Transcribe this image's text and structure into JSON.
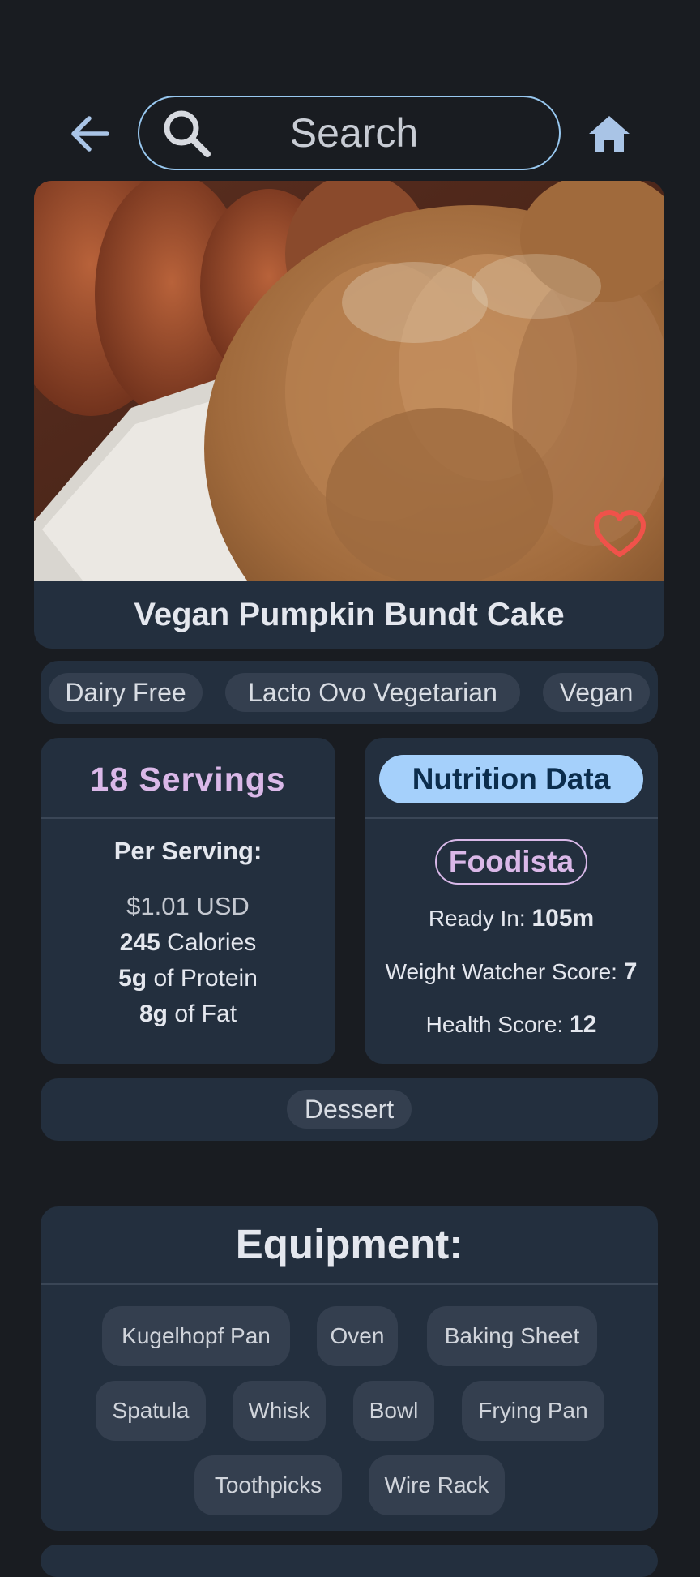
{
  "search": {
    "placeholder": "Search"
  },
  "recipe": {
    "title": "Vegan Pumpkin Bundt Cake",
    "favorited": false,
    "diets": [
      "Dairy Free",
      "Lacto Ovo Vegetarian",
      "Vegan"
    ],
    "dish_types": [
      "Dessert"
    ]
  },
  "servings": {
    "title": "18 Servings",
    "per_serving_label": "Per Serving:",
    "price": "$1.01 USD",
    "calories_value": "245",
    "calories_label": "Calories",
    "protein_value": "5g",
    "protein_label": "of Protein",
    "fat_value": "8g",
    "fat_label": "of Fat"
  },
  "nutrition": {
    "button_label": "Nutrition Data",
    "source": "Foodista",
    "ready_label": "Ready In:",
    "ready_value": "105m",
    "ww_label": "Weight Watcher Score:",
    "ww_value": "7",
    "health_label": "Health Score:",
    "health_value": "12"
  },
  "equipment": {
    "title": "Equipment:",
    "items": [
      "Kugelhopf Pan",
      "Oven",
      "Baking Sheet",
      "Spatula",
      "Whisk",
      "Bowl",
      "Frying Pan",
      "Toothpicks",
      "Wire Rack"
    ]
  },
  "colors": {
    "background": "#191c21",
    "card": "#232f3e",
    "chip": "#343f4f",
    "accent_blue": "#a5d0fb",
    "accent_purple": "#dab8e8",
    "favorite_red": "#f0524a"
  },
  "icons": {
    "back": "arrow-left-icon",
    "search": "search-icon",
    "home": "home-icon",
    "favorite": "heart-outline-icon"
  }
}
